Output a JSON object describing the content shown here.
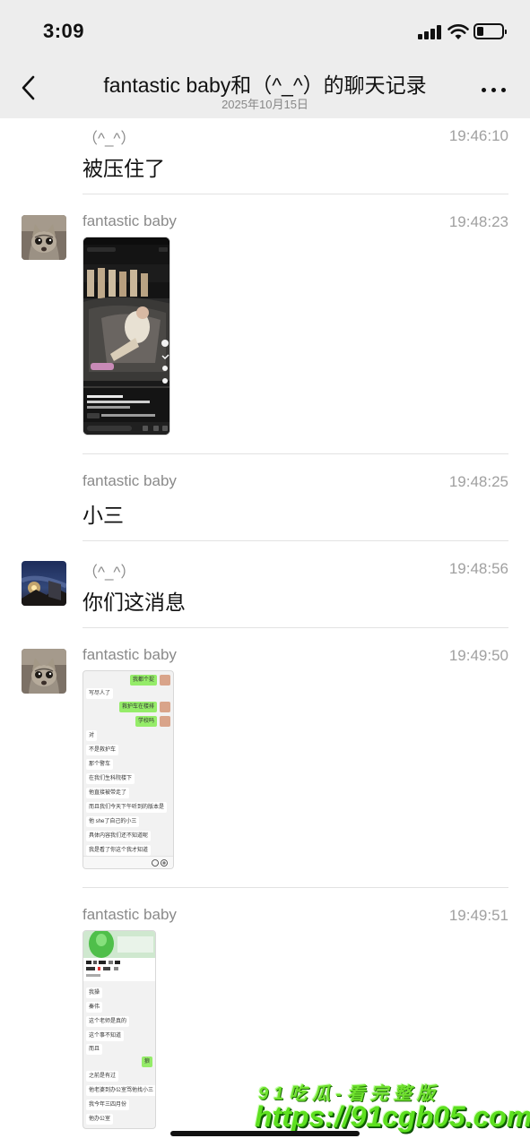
{
  "status_bar": {
    "time": "3:09"
  },
  "nav": {
    "title": "fantastic baby和（^_^）的聊天记录",
    "date": "2025年10月15日"
  },
  "messages": [
    {
      "sender": "（^_^）",
      "time": "19:46:10",
      "text": "被压住了",
      "avatar": "night-sky-avatar"
    },
    {
      "sender": "fantastic baby",
      "time": "19:48:23",
      "type": "image",
      "avatar": "cat-avatar"
    },
    {
      "sender": "fantastic baby",
      "time": "19:48:25",
      "text": "小三"
    },
    {
      "sender": "（^_^）",
      "time": "19:48:56",
      "text": "你们这消息",
      "avatar": "night-sky-avatar"
    },
    {
      "sender": "fantastic baby",
      "time": "19:49:50",
      "type": "image",
      "avatar": "cat-avatar"
    },
    {
      "sender": "fantastic baby",
      "time": "19:49:51",
      "type": "image"
    }
  ],
  "screenshot1": {
    "bubbles": [
      {
        "text": "我都个捉",
        "mine": true
      },
      {
        "text": "写尽人了",
        "mine": false
      },
      {
        "text": "救护车在楼排",
        "mine": true
      },
      {
        "text": "学校吗",
        "mine": true
      },
      {
        "text": "对",
        "mine": false
      },
      {
        "text": "不是救护车",
        "mine": false
      },
      {
        "text": "那个警车",
        "mine": false
      },
      {
        "text": "在我们生科院楼下",
        "mine": false
      },
      {
        "text": "他直接被带走了",
        "mine": false
      },
      {
        "text": "而且我们今天下午听到的版本是",
        "mine": false
      },
      {
        "text": "他 she了自己的小三",
        "mine": false
      },
      {
        "text": "具体内容我们还不知道呢",
        "mine": false
      },
      {
        "text": "我是看了你这个我才知道",
        "mine": false
      }
    ]
  },
  "screenshot2": {
    "bubbles": [
      {
        "text": "我操",
        "mine": false
      },
      {
        "text": "秦伟",
        "mine": false
      },
      {
        "text": "这个老师是真的",
        "mine": false
      },
      {
        "text": "这个事不知道",
        "mine": false
      },
      {
        "text": "而且",
        "mine": false
      },
      {
        "text": "狼",
        "mine": true
      },
      {
        "text": "之前是有过",
        "mine": false
      },
      {
        "text": "他老婆到办公室骂他找小三",
        "mine": false
      },
      {
        "text": "我今年三四月份",
        "mine": false
      },
      {
        "text": "他办公室",
        "mine": false
      }
    ]
  },
  "watermark": {
    "line1": "91吃瓜-看完整版",
    "line2": "https://91cgb05.com"
  },
  "colors": {
    "header_bg": "#ededed",
    "my_bubble": "#95ec69",
    "watermark_green": "#5ee020"
  }
}
